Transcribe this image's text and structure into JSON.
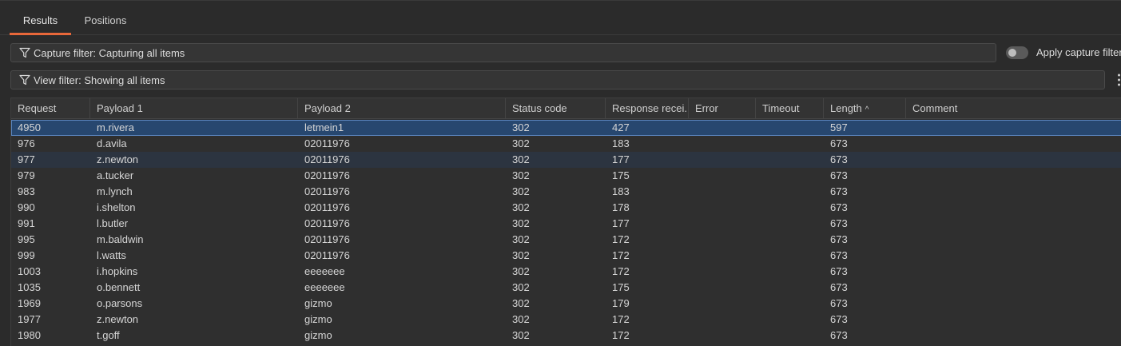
{
  "tabs": [
    {
      "label": "Results",
      "active": true
    },
    {
      "label": "Positions",
      "active": false
    }
  ],
  "capture_filter": {
    "label": "Capture filter: Capturing all items"
  },
  "apply_capture_filter": {
    "label": "Apply capture filter",
    "enabled": false
  },
  "view_filter": {
    "label": "View filter: Showing all items"
  },
  "table": {
    "columns": [
      "Request",
      "Payload 1",
      "Payload 2",
      "Status code",
      "Response recei...",
      "Error",
      "Timeout",
      "Length",
      "Comment"
    ],
    "sorted_column": "Length",
    "sort_direction": "ascending",
    "rows": [
      {
        "request": "4950",
        "payload1": "m.rivera",
        "payload2": "letmein1",
        "status": "302",
        "response": "427",
        "error": "",
        "timeout": "",
        "length": "597",
        "comment": ""
      },
      {
        "request": "976",
        "payload1": "d.avila",
        "payload2": "02011976",
        "status": "302",
        "response": "183",
        "error": "",
        "timeout": "",
        "length": "673",
        "comment": ""
      },
      {
        "request": "977",
        "payload1": "z.newton",
        "payload2": "02011976",
        "status": "302",
        "response": "177",
        "error": "",
        "timeout": "",
        "length": "673",
        "comment": ""
      },
      {
        "request": "979",
        "payload1": "a.tucker",
        "payload2": "02011976",
        "status": "302",
        "response": "175",
        "error": "",
        "timeout": "",
        "length": "673",
        "comment": ""
      },
      {
        "request": "983",
        "payload1": "m.lynch",
        "payload2": "02011976",
        "status": "302",
        "response": "183",
        "error": "",
        "timeout": "",
        "length": "673",
        "comment": ""
      },
      {
        "request": "990",
        "payload1": "i.shelton",
        "payload2": "02011976",
        "status": "302",
        "response": "178",
        "error": "",
        "timeout": "",
        "length": "673",
        "comment": ""
      },
      {
        "request": "991",
        "payload1": "l.butler",
        "payload2": "02011976",
        "status": "302",
        "response": "177",
        "error": "",
        "timeout": "",
        "length": "673",
        "comment": ""
      },
      {
        "request": "995",
        "payload1": "m.baldwin",
        "payload2": "02011976",
        "status": "302",
        "response": "172",
        "error": "",
        "timeout": "",
        "length": "673",
        "comment": ""
      },
      {
        "request": "999",
        "payload1": "l.watts",
        "payload2": "02011976",
        "status": "302",
        "response": "172",
        "error": "",
        "timeout": "",
        "length": "673",
        "comment": ""
      },
      {
        "request": "1003",
        "payload1": "i.hopkins",
        "payload2": "eeeeeee",
        "status": "302",
        "response": "172",
        "error": "",
        "timeout": "",
        "length": "673",
        "comment": ""
      },
      {
        "request": "1035",
        "payload1": "o.bennett",
        "payload2": "eeeeeee",
        "status": "302",
        "response": "175",
        "error": "",
        "timeout": "",
        "length": "673",
        "comment": ""
      },
      {
        "request": "1969",
        "payload1": "o.parsons",
        "payload2": "gizmo",
        "status": "302",
        "response": "179",
        "error": "",
        "timeout": "",
        "length": "673",
        "comment": ""
      },
      {
        "request": "1977",
        "payload1": "z.newton",
        "payload2": "gizmo",
        "status": "302",
        "response": "172",
        "error": "",
        "timeout": "",
        "length": "673",
        "comment": ""
      },
      {
        "request": "1980",
        "payload1": "t.goff",
        "payload2": "gizmo",
        "status": "302",
        "response": "172",
        "error": "",
        "timeout": "",
        "length": "673",
        "comment": ""
      }
    ]
  },
  "colors": {
    "accent": "#e8683a",
    "selection": "#27476f",
    "hover_row": "#2c3440",
    "background": "#2b2b2b"
  },
  "icons": {
    "filter": "filter-icon",
    "sort": "sort-ascending-icon",
    "menu": "kebab-menu-icon"
  }
}
